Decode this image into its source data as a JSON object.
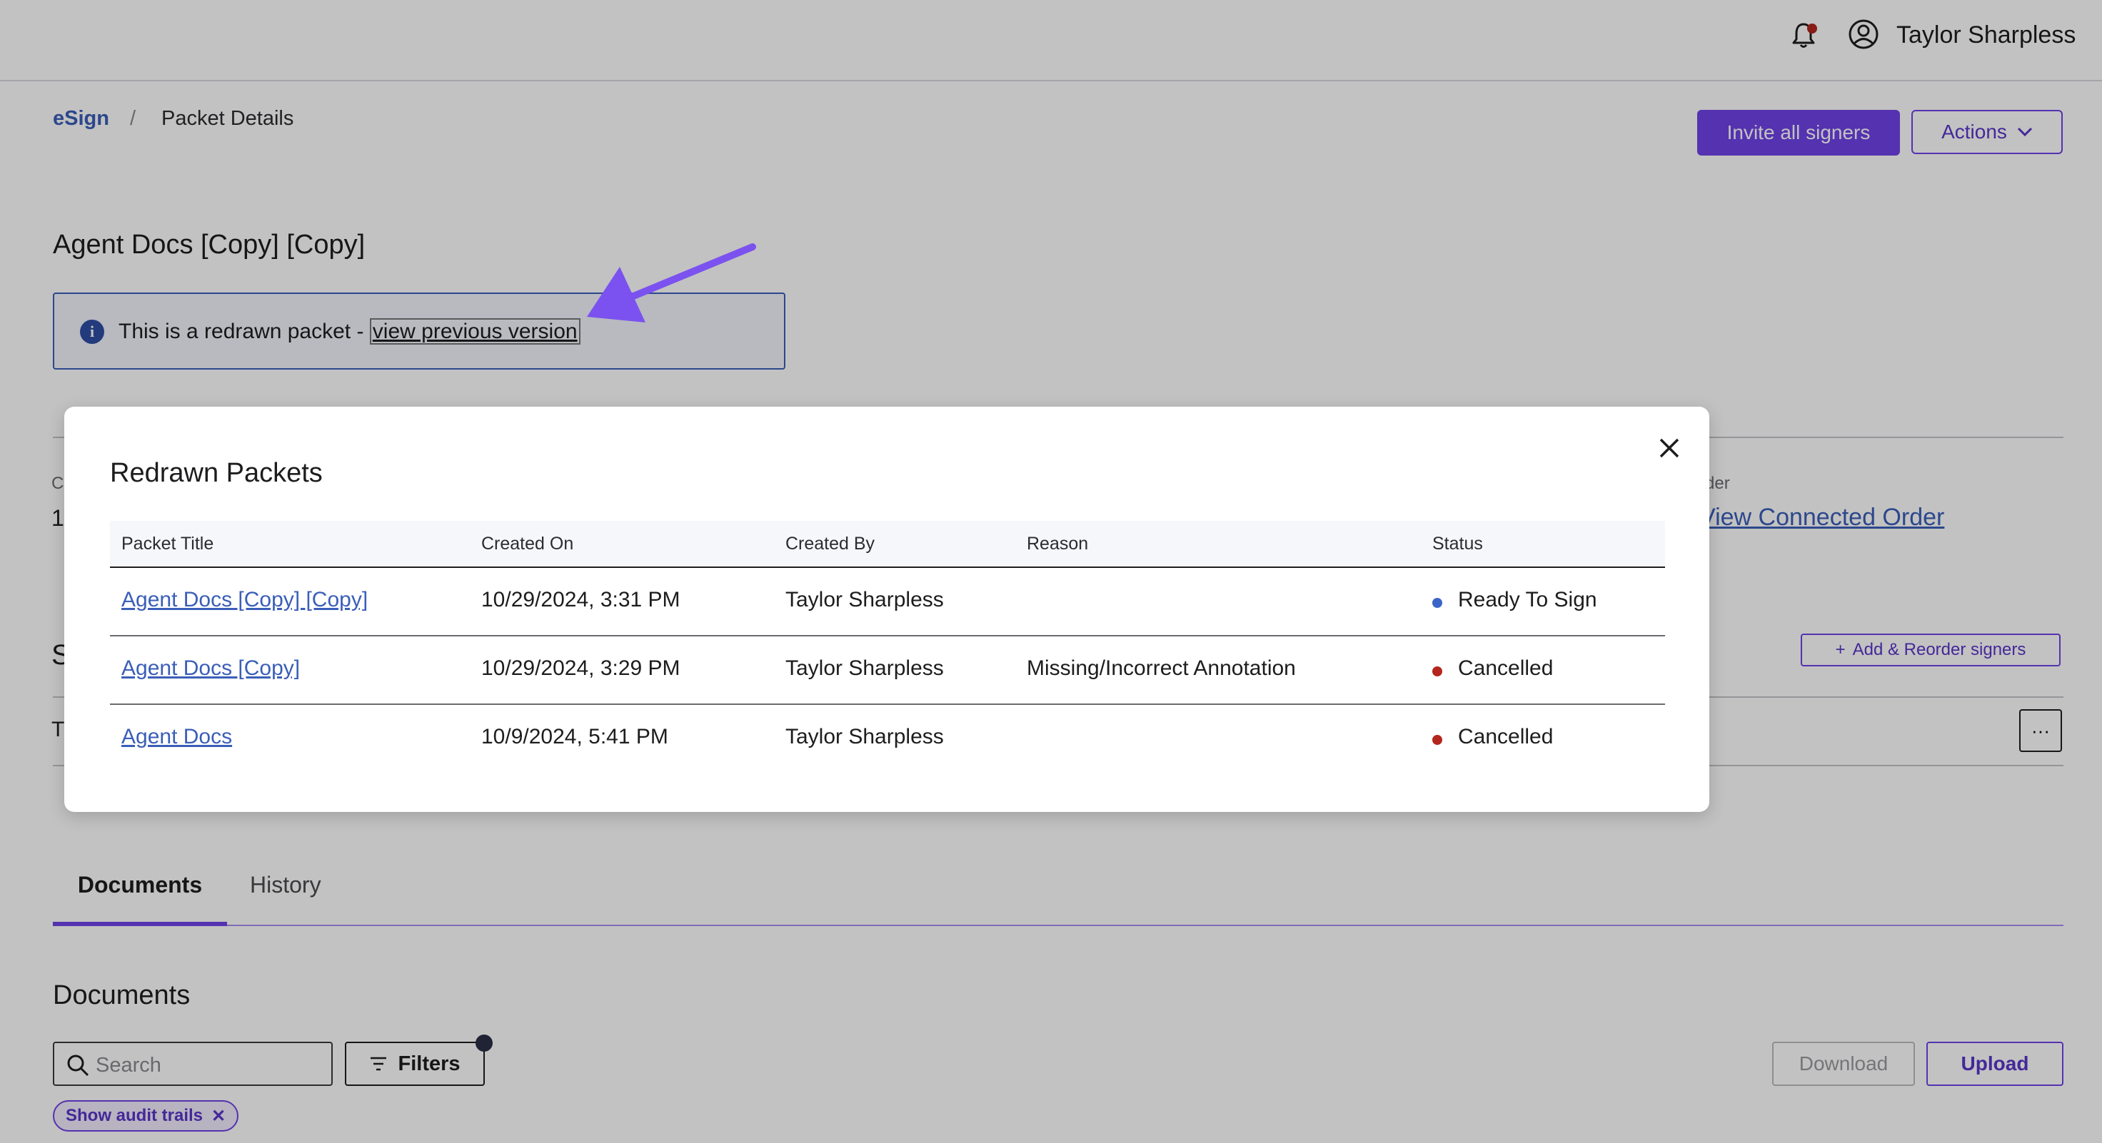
{
  "header": {
    "user_name": "Taylor Sharpless"
  },
  "breadcrumb": {
    "root": "eSign",
    "separator": "/",
    "current": "Packet Details"
  },
  "actions": {
    "invite_label": "Invite all signers",
    "actions_label": "Actions"
  },
  "packet": {
    "title": "Agent Docs [Copy] [Copy]",
    "notice_text": "This is a redrawn packet - ",
    "notice_link": "view previous version"
  },
  "background": {
    "truncated_c": "C",
    "truncated_1": "1",
    "order_label": "rder",
    "order_link": "View Connected Order",
    "truncated_s": "S",
    "truncated_t": "T",
    "add_signers_label": "Add & Reorder signers",
    "more_label": "···"
  },
  "tabs": [
    {
      "label": "Documents",
      "active": true
    },
    {
      "label": "History",
      "active": false
    }
  ],
  "documents": {
    "heading": "Documents",
    "search_placeholder": "Search",
    "filters_label": "Filters",
    "download_label": "Download",
    "upload_label": "Upload",
    "chip_label": "Show audit trails"
  },
  "modal": {
    "title": "Redrawn Packets",
    "columns": [
      "Packet Title",
      "Created On",
      "Created By",
      "Reason",
      "Status"
    ],
    "rows": [
      {
        "title": "Agent Docs [Copy] [Copy]",
        "created_on": "10/29/2024, 3:31 PM",
        "created_by": "Taylor Sharpless",
        "reason": "",
        "status": "Ready To Sign",
        "status_color": "#3a64c8"
      },
      {
        "title": "Agent Docs [Copy]",
        "created_on": "10/29/2024, 3:29 PM",
        "created_by": "Taylor Sharpless",
        "reason": "Missing/Incorrect Annotation",
        "status": "Cancelled",
        "status_color": "#b3261e"
      },
      {
        "title": "Agent Docs",
        "created_on": "10/9/2024, 5:41 PM",
        "created_by": "Taylor Sharpless",
        "reason": "",
        "status": "Cancelled",
        "status_color": "#b3261e"
      }
    ]
  },
  "colors": {
    "accent": "#6f42e8",
    "link": "#3a5eb8",
    "annotation_arrow": "#7b52f0"
  }
}
